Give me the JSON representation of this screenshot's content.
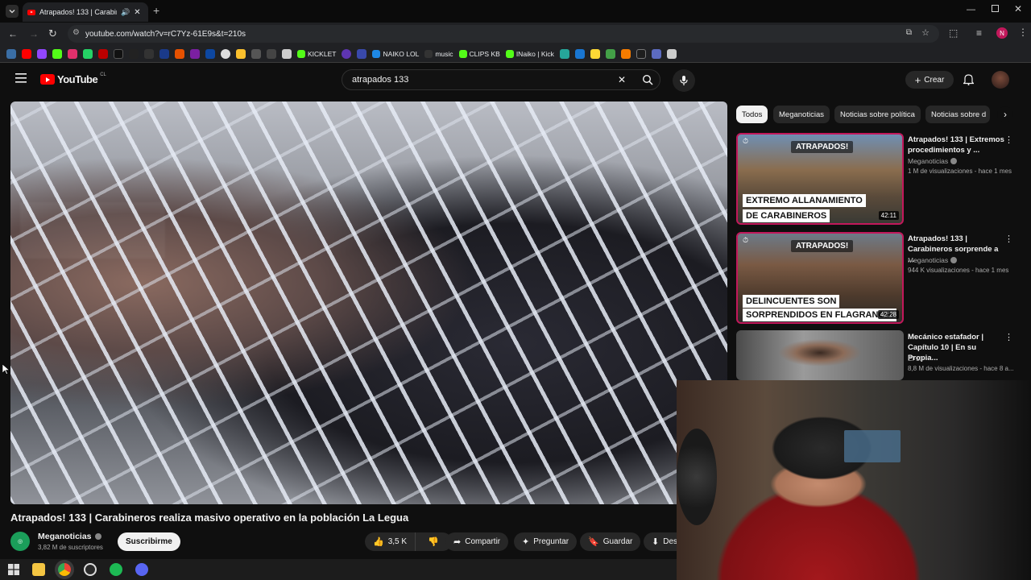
{
  "browser": {
    "tab_title": "Atrapados! 133 | Carabinero",
    "url": "youtube.com/watch?v=rC7Yz-61E9s&t=210s",
    "new_tab_label": "+",
    "bookmarks": [
      "KICKLET",
      "NAIKO LOL",
      "music",
      "CLIPS KB",
      "INaiko | Kick"
    ],
    "profile_initial": "N"
  },
  "youtube": {
    "logo_text": "YouTube",
    "region": "CL",
    "search_value": "atrapados 133",
    "create_label": "Crear",
    "chips": [
      "Todos",
      "Meganoticias",
      "Noticias sobre política",
      "Noticias sobre d"
    ]
  },
  "video": {
    "title": "Atrapados! 133 | Carabineros realiza masivo operativo en la población La Legua",
    "channel": "Meganoticias",
    "subscribers": "3,82 M de suscriptores",
    "subscribe_label": "Suscribirme",
    "likes": "3,5 K",
    "share_label": "Compartir",
    "ask_label": "Preguntar",
    "save_label": "Guardar",
    "download_label": "Desc"
  },
  "recommendations": [
    {
      "title": "Atrapados! 133 | Extremos procedimientos y ...",
      "channel": "Meganoticias",
      "meta": "1 M de visualizaciones - hace 1 mes",
      "thumb_tag": "ATRAPADOS!",
      "thumb_banner_1": "EXTREMO ALLANAMIENTO",
      "thumb_banner_2": "DE CARABINEROS",
      "duration": "42:11"
    },
    {
      "title": "Atrapados! 133 | Carabineros sorprende a ...",
      "channel": "Meganoticias",
      "meta": "944 K visualizaciones - hace 1 mes",
      "thumb_tag": "ATRAPADOS!",
      "thumb_banner_1": "DELINCUENTES SON",
      "thumb_banner_2": "SORPRENDIDOS EN FLAGRANCIA",
      "duration": "42:28"
    },
    {
      "title": "Mecánico estafador | Capítulo 10 | En su Propia...",
      "channel": "El 13",
      "meta": "8,8 M de visualizaciones - hace 8 a..."
    }
  ],
  "colors": {
    "youtube_red": "#ff0000",
    "background": "#0f0f0f",
    "chip_active": "#f1f1f1"
  }
}
